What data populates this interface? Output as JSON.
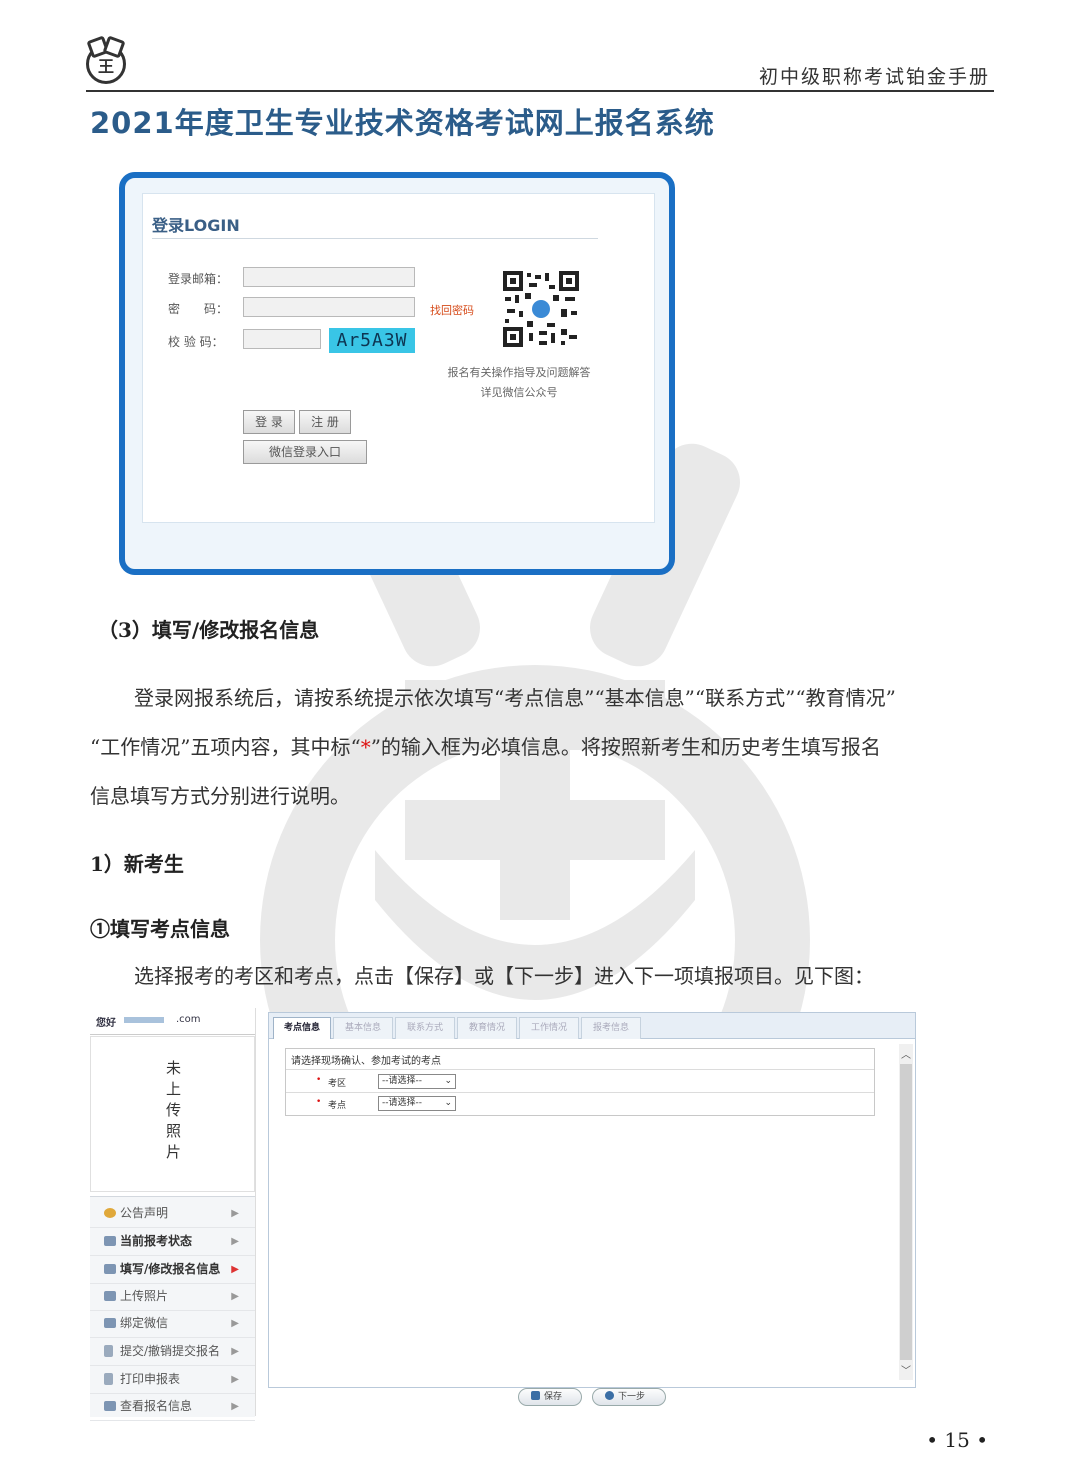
{
  "header": {
    "logo_text": "王",
    "book_title": "初中级职称考试铂金手册"
  },
  "system_title": "2021年度卫生专业技术资格考试网上报名系统",
  "login": {
    "heading": "登录LOGIN",
    "email_label": "登录邮箱：",
    "password_label": "密　　码：",
    "captcha_label": "校 验 码：",
    "captcha_text": "Ar5A3W",
    "forgot_password": "找回密码",
    "qr_caption_line1": "报名有关操作指导及问题解答",
    "qr_caption_line2": "详见微信公众号",
    "login_button": "登 录",
    "register_button": "注 册",
    "wechat_button": "微信登录入口"
  },
  "section": {
    "heading": "（3）填写/修改报名信息",
    "para1_line1": "登录网报系统后，请按系统提示依次填写“考点信息”“基本信息”“联系方式”“教育情况”",
    "para1_line2_a": "“工作情况”五项内容，其中标“",
    "para1_star": "*",
    "para1_line2_b": "”的输入框为必填信息。将按照新考生和历史考生填写报名",
    "para1_line3": "信息填写方式分别进行说明。",
    "sub_heading": "1）新考生",
    "step_heading": "①填写考点信息",
    "para2": "选择报考的考区和考点，点击【保存】或【下一步】进入下一项填报项目。见下图："
  },
  "app": {
    "greeting": "您好",
    "email_suffix": ".com",
    "photo_placeholder": [
      "未",
      "上",
      "传",
      "照",
      "片"
    ],
    "menu": [
      {
        "label": "公告声明",
        "bold": false
      },
      {
        "label": "当前报考状态",
        "bold": true
      },
      {
        "label": "填写/修改报名信息",
        "bold": true
      },
      {
        "label": "上传照片",
        "bold": false
      },
      {
        "label": "绑定微信",
        "bold": false
      },
      {
        "label": "提交/撤销提交报名",
        "bold": false
      },
      {
        "label": "打印申报表",
        "bold": false
      },
      {
        "label": "查看报名信息",
        "bold": false
      }
    ],
    "tabs": [
      "考点信息",
      "基本信息",
      "联系方式",
      "教育情况",
      "工作情况",
      "报考信息"
    ],
    "form_hint": "请选择现场确认、参加考试的考点",
    "field_area_label": "考区",
    "field_site_label": "考点",
    "required_mark": "•",
    "select_default": "--请选择-- ",
    "save_button": "保存",
    "next_button": "下一步"
  },
  "page_number": "• 15 •"
}
